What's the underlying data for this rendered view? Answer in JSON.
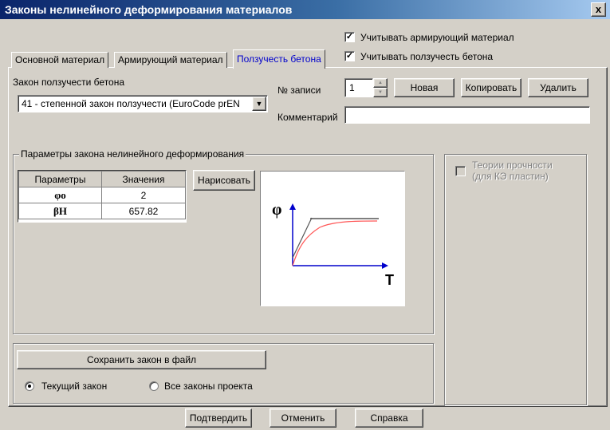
{
  "window": {
    "title": "Законы нелинейного деформирования материалов",
    "close_label": "x"
  },
  "top_checks": [
    {
      "label": "Учитывать армирующий материал",
      "checked": true
    },
    {
      "label": "Учитывать ползучесть бетона",
      "checked": true
    }
  ],
  "tabs": [
    {
      "label": "Основной материал",
      "active": false
    },
    {
      "label": "Армирующий материал",
      "active": false
    },
    {
      "label": "Ползучесть бетона",
      "active": true
    }
  ],
  "creep_law": {
    "label": "Закон ползучести бетона",
    "selected": "41 - степенной закон ползучести (EuroCode prEN",
    "dropdown_glyph": "▼"
  },
  "record": {
    "label": "№ записи",
    "value": "1",
    "up": "▲",
    "down": "▼",
    "new_label": "Новая",
    "copy_label": "Копировать",
    "delete_label": "Удалить"
  },
  "comment": {
    "label": "Комментарий",
    "value": ""
  },
  "params_group": {
    "title": "Параметры закона нелинейного деформирования",
    "header_param": "Параметры",
    "header_value": "Значения",
    "rows": [
      {
        "param": "φo",
        "value": "2"
      },
      {
        "param": "βH",
        "value": "657.82"
      }
    ],
    "draw_label": "Нарисовать"
  },
  "plot": {
    "ylabel": "φ",
    "xlabel": "T",
    "axis_color": "#0000cc",
    "curve_color": "#ff5555",
    "asymptote_color": "#555555"
  },
  "strength_theory": {
    "label_line1": "Теории прочности",
    "label_line2": "(для КЭ пластин)",
    "checked": false,
    "enabled": false
  },
  "save": {
    "button_label": "Сохранить закон в файл",
    "options": [
      {
        "label": "Текущий закон",
        "selected": true
      },
      {
        "label": "Все законы проекта",
        "selected": false
      }
    ]
  },
  "footer": {
    "confirm_label": "Подтвердить",
    "cancel_label": "Отменить",
    "help_label": "Справка"
  }
}
